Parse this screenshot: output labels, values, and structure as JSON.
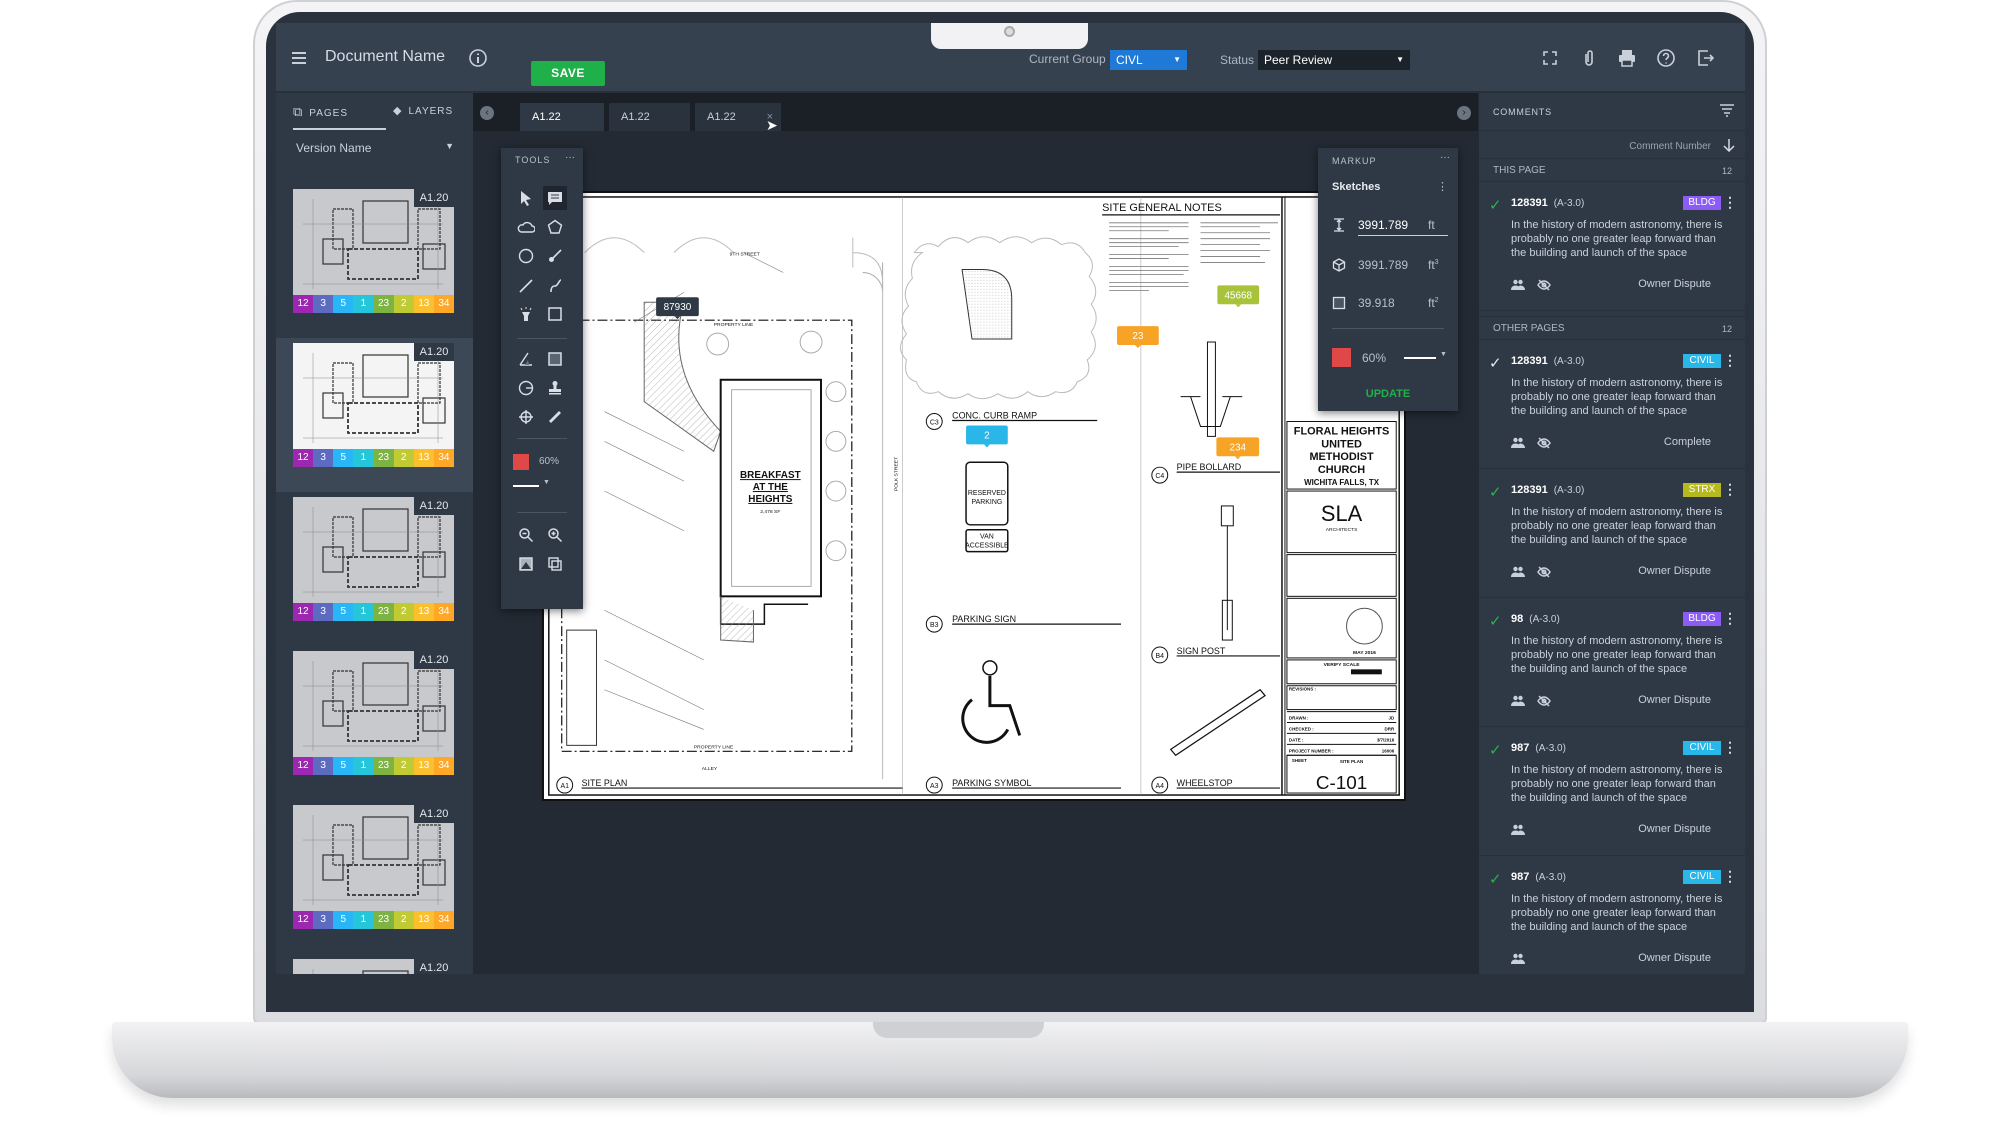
{
  "header": {
    "document_name": "Document Name",
    "save_label": "SAVE",
    "current_group_label": "Current Group",
    "current_group_value": "CIVL",
    "status_label": "Status",
    "status_value": "Peer Review",
    "icons": [
      "menu-icon",
      "info-icon",
      "fullscreen-icon",
      "attachment-icon",
      "print-icon",
      "help-icon",
      "export-icon"
    ]
  },
  "left_panel": {
    "tabs": [
      {
        "label": "PAGES",
        "active": true
      },
      {
        "label": "LAYERS",
        "active": false
      }
    ],
    "version_label": "Version Name",
    "pages": [
      {
        "label": "A1.20",
        "active": false
      },
      {
        "label": "A1.20",
        "active": true
      },
      {
        "label": "A1.20",
        "active": false
      },
      {
        "label": "A1.20",
        "active": false
      },
      {
        "label": "A1.20",
        "active": false
      },
      {
        "label": "A1.20",
        "active": false
      }
    ],
    "badges": [
      {
        "value": "12",
        "color": "#9c27b0"
      },
      {
        "value": "3",
        "color": "#5c6bc0"
      },
      {
        "value": "5",
        "color": "#29b6f6"
      },
      {
        "value": "1",
        "color": "#26c6da"
      },
      {
        "value": "23",
        "color": "#7cb342"
      },
      {
        "value": "2",
        "color": "#c0ca33"
      },
      {
        "value": "13",
        "color": "#fbc02d"
      },
      {
        "value": "34",
        "color": "#ffa726"
      }
    ]
  },
  "doc_tabs": [
    {
      "label": "A1.22",
      "active": true
    },
    {
      "label": "A1.22",
      "active": false
    },
    {
      "label": "A1.22",
      "active": false,
      "close": "×"
    }
  ],
  "tools": {
    "title": "TOOLS",
    "more": "···",
    "opacity": "60%",
    "color": "#e04848"
  },
  "markup": {
    "title": "MARKUP",
    "more": "···",
    "group": "Sketches",
    "length_value": "3991.789",
    "length_unit": "ft",
    "volume_value": "3991.789",
    "volume_unit": "ft",
    "volume_exp": "3",
    "area_value": "39.918",
    "area_unit": "ft",
    "area_exp": "2",
    "opacity": "60%",
    "color": "#e04848",
    "update_label": "UPDATE"
  },
  "drawing": {
    "notes_title": "SITE GENERAL NOTES",
    "building": [
      "BREAKFAST",
      "AT THE",
      "HEIGHTS"
    ],
    "building_area": "2,478 SF",
    "street_top": "9TH STREET",
    "street_right": "POLK STREET",
    "property_line": "PROPERTY LINE",
    "alley": "ALLEY",
    "sign_reserved": [
      "RESERVED",
      "PARKING"
    ],
    "sign_van": [
      "VAN",
      "ACCESSIBLE"
    ],
    "details": [
      {
        "id": "C3",
        "title": "CONC. CURB RAMP"
      },
      {
        "id": "C4",
        "title": "PIPE BOLLARD"
      },
      {
        "id": "B3",
        "title": "PARKING SIGN"
      },
      {
        "id": "B4",
        "title": "SIGN POST"
      },
      {
        "id": "A1",
        "title": "SITE PLAN"
      },
      {
        "id": "A3",
        "title": "PARKING SYMBOL"
      },
      {
        "id": "A4",
        "title": "WHEELSTOP"
      }
    ],
    "markers": [
      {
        "value": "87930",
        "color": "#2f3946"
      },
      {
        "value": "45668",
        "color": "#a8c23a"
      },
      {
        "value": "23",
        "color": "#f7a325"
      },
      {
        "value": "2",
        "color": "#29b6e8"
      },
      {
        "value": "234",
        "color": "#f7a325"
      }
    ],
    "title_block": {
      "project": [
        "FLORAL HEIGHTS",
        "UNITED",
        "METHODIST",
        "CHURCH"
      ],
      "location": "WICHITA FALLS, TX",
      "firm": "SLA",
      "firm_sub": "ARCHITECTS",
      "seal_date": "MAY 2016",
      "verify_scale": "VERIFY SCALE",
      "revisions": "REVISIONS :",
      "drawn_label": "DRAWN :",
      "drawn": "JD",
      "checked_label": "CHECKED :",
      "checked": "DRR",
      "date_label": "DATE :",
      "date": "3/7/2016",
      "project_number_label": "PROJECT NUMBER :",
      "project_number": "16006",
      "sheet_label": "SHEET",
      "sheet_title": "SITE PLAN",
      "sheet_number": "C-101"
    }
  },
  "comments": {
    "title": "COMMENTS",
    "sort_label": "Comment Number",
    "this_page_label": "THIS PAGE",
    "this_page_count": "12",
    "other_pages_label": "OTHER PAGES",
    "other_pages_count": "12",
    "items": [
      {
        "number": "128391",
        "ref": "(A-3.0)",
        "tag": "BLDG",
        "tag_color": "#8b5cf6",
        "resolved_color": "#2bb24c",
        "text": "In the history of modern astronomy, there is probably no one greater leap forward than the building and launch of the space",
        "status": "Owner Dispute",
        "hidden_icon": true
      },
      {
        "number": "128391",
        "ref": "(A-3.0)",
        "tag": "CIVIL",
        "tag_color": "#29b6e8",
        "resolved_color": "#e6e9ee",
        "text": "In the history of modern astronomy, there is probably no one greater leap forward than the building and launch of the space",
        "status": "Complete",
        "hidden_icon": true
      },
      {
        "number": "128391",
        "ref": "(A-3.0)",
        "tag": "STRX",
        "tag_color": "#b5b81f",
        "resolved_color": "#2bb24c",
        "text": "In the history of modern astronomy, there is probably no one greater leap forward than the building and launch of the space",
        "status": "Owner Dispute",
        "hidden_icon": true
      },
      {
        "number": "98",
        "ref": "(A-3.0)",
        "tag": "BLDG",
        "tag_color": "#8b5cf6",
        "resolved_color": "#2bb24c",
        "text": "In the history of modern astronomy, there is probably no one greater leap forward than the building and launch of the space",
        "status": "Owner Dispute",
        "hidden_icon": true
      },
      {
        "number": "987",
        "ref": "(A-3.0)",
        "tag": "CIVIL",
        "tag_color": "#29b6e8",
        "resolved_color": "#2bb24c",
        "text": "In the history of modern astronomy, there is probably no one greater leap forward than the building and launch of the space",
        "status": "Owner Dispute",
        "hidden_icon": false
      },
      {
        "number": "987",
        "ref": "(A-3.0)",
        "tag": "CIVIL",
        "tag_color": "#29b6e8",
        "resolved_color": "#2bb24c",
        "text": "In the history of modern astronomy, there is probably no one greater leap forward than the building and launch of the space",
        "status": "Owner Dispute",
        "hidden_icon": false
      }
    ]
  }
}
